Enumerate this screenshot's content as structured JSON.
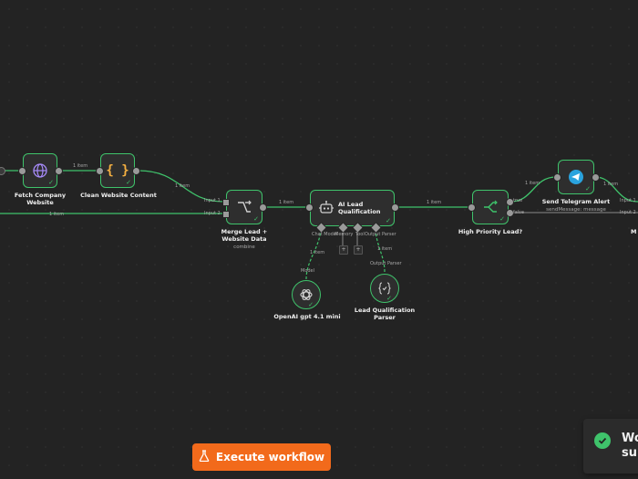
{
  "nodes": {
    "fetch": {
      "label": "Fetch Company Website"
    },
    "clean": {
      "label": "Clean Website Content"
    },
    "merge": {
      "label": "Merge Lead + Website Data",
      "sub": "combine",
      "in1": "Input 1",
      "in2": "Input 2"
    },
    "ai": {
      "label": "AI Lead Qualification",
      "port_model": "Chat Model",
      "port_memory": "Memory",
      "port_tool": "Tool",
      "port_parser": "Output Parser"
    },
    "openai": {
      "label": "OpenAI gpt 4.1 mini",
      "port": "Model"
    },
    "parser": {
      "label": "Lead Qualification Parser",
      "port": "Output Parser"
    },
    "if": {
      "label": "High Priority Lead?",
      "out_true": "true",
      "out_false": "false"
    },
    "telegram": {
      "label": "Send Telegram Alert",
      "sub": "sendMessage: message"
    },
    "edge_right": {
      "in1": "Input 1",
      "in2": "Input 2",
      "label_partial": "M"
    }
  },
  "edge_labels": {
    "fetch_clean": "1 item",
    "clean_merge": "1 item",
    "bypass_merge": "1 item",
    "merge_ai": "1 item",
    "ai_if": "1 item",
    "if_telegram": "1 item",
    "telegram_out": "1 item",
    "openai_ai": "1 item",
    "parser_ai": "1 item"
  },
  "execute_button": {
    "label": "Execute workflow"
  },
  "toast": {
    "line1": "Wo",
    "line2": "su"
  },
  "colors": {
    "accent_green": "#3fc36b",
    "execute_orange": "#f26a1b",
    "canvas_bg": "#232323",
    "telegram_blue": "#2aa3de"
  }
}
